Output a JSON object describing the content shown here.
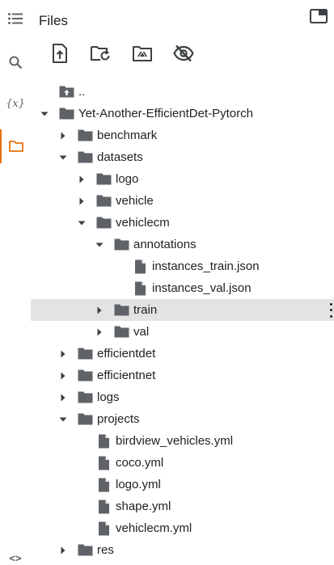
{
  "header": {
    "title": "Files"
  },
  "rail": {
    "variables_label": "{x}",
    "code_label": "<>"
  },
  "toolbar": {
    "buttons": [
      {
        "icon": "upload-file-icon"
      },
      {
        "icon": "refresh-folder-icon"
      },
      {
        "icon": "mount-drive-icon"
      },
      {
        "icon": "hide-hidden-files-icon"
      }
    ]
  },
  "tree": {
    "items": [
      {
        "label": "..",
        "type": "parent",
        "depth": 0
      },
      {
        "label": "Yet-Another-EfficientDet-Pytorch",
        "type": "folder",
        "depth": 0,
        "expanded": true
      },
      {
        "label": "benchmark",
        "type": "folder",
        "depth": 1,
        "expanded": false
      },
      {
        "label": "datasets",
        "type": "folder",
        "depth": 1,
        "expanded": true
      },
      {
        "label": "logo",
        "type": "folder",
        "depth": 2,
        "expanded": false
      },
      {
        "label": "vehicle",
        "type": "folder",
        "depth": 2,
        "expanded": false
      },
      {
        "label": "vehiclecm",
        "type": "folder",
        "depth": 2,
        "expanded": true
      },
      {
        "label": "annotations",
        "type": "folder",
        "depth": 3,
        "expanded": true
      },
      {
        "label": "instances_train.json",
        "type": "file",
        "depth": 4
      },
      {
        "label": "instances_val.json",
        "type": "file",
        "depth": 4
      },
      {
        "label": "train",
        "type": "folder",
        "depth": 3,
        "expanded": false,
        "selected": true
      },
      {
        "label": "val",
        "type": "folder",
        "depth": 3,
        "expanded": false
      },
      {
        "label": "efficientdet",
        "type": "folder",
        "depth": 1,
        "expanded": false
      },
      {
        "label": "efficientnet",
        "type": "folder",
        "depth": 1,
        "expanded": false
      },
      {
        "label": "logs",
        "type": "folder",
        "depth": 1,
        "expanded": false
      },
      {
        "label": "projects",
        "type": "folder",
        "depth": 1,
        "expanded": true
      },
      {
        "label": "birdview_vehicles.yml",
        "type": "file",
        "depth": 2
      },
      {
        "label": "coco.yml",
        "type": "file",
        "depth": 2
      },
      {
        "label": "logo.yml",
        "type": "file",
        "depth": 2
      },
      {
        "label": "shape.yml",
        "type": "file",
        "depth": 2
      },
      {
        "label": "vehiclecm.yml",
        "type": "file",
        "depth": 2
      },
      {
        "label": "res",
        "type": "folder",
        "depth": 1,
        "expanded": false
      }
    ]
  },
  "colors": {
    "accent": "#e8710a",
    "icon": "#5f6368",
    "selected_row": "#e3e3e3",
    "folder": "#5f6368"
  }
}
